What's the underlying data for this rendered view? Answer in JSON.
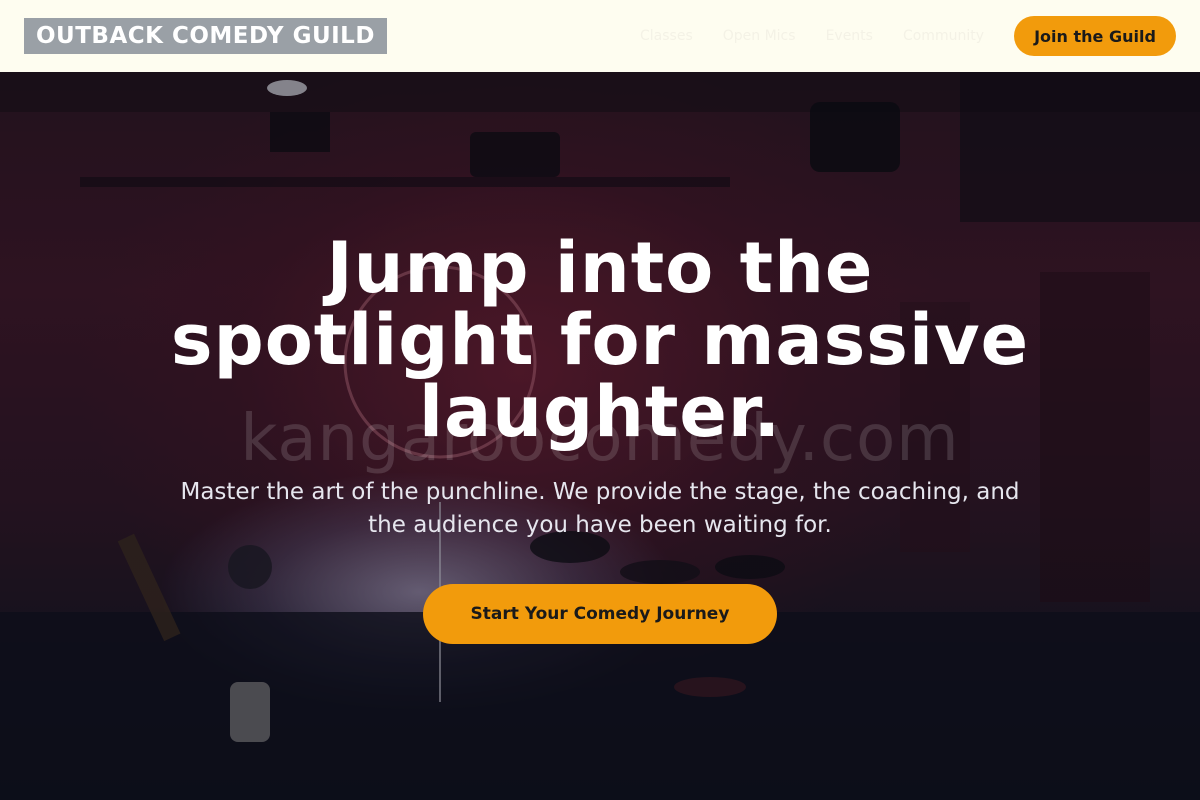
{
  "brand": {
    "logo_text": "OUTBACK COMEDY GUILD"
  },
  "nav": {
    "links": [
      "Classes",
      "Open Mics",
      "Events",
      "Community"
    ],
    "join_label": "Join the Guild"
  },
  "hero": {
    "title": "Jump into the spotlight for massive laughter.",
    "watermark": "kangaroocomedy.com",
    "subtitle": "Master the art of the punchline. We provide the stage, the coaching, and the audience you have been waiting for.",
    "cta_label": "Start Your Comedy Journey"
  },
  "colors": {
    "nav_bg": "#fefdf0",
    "accent": "#f29b0c",
    "logo_bg": "#9aa0a6",
    "hero_dark": "#12131f"
  }
}
